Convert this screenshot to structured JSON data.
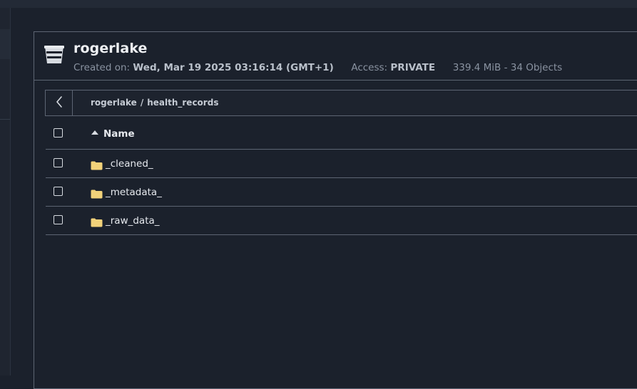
{
  "bucket": {
    "name": "rogerlake",
    "created_label": "Created on:",
    "created_value": "Wed, Mar 19 2025 03:16:14 (GMT+1)",
    "access_label": "Access:",
    "access_value": "PRIVATE",
    "size_objects": "339.4 MiB - 34 Objects"
  },
  "breadcrumb": {
    "root": "rogerlake",
    "separator": "/",
    "current": "health_records"
  },
  "table": {
    "columns": {
      "name": "Name"
    },
    "sort": "ascending",
    "rows": [
      {
        "name": "_cleaned_",
        "type": "folder"
      },
      {
        "name": "_metadata_",
        "type": "folder"
      },
      {
        "name": "_raw_data_",
        "type": "folder"
      }
    ]
  },
  "icons": {
    "bucket": "bucket-icon",
    "back": "chevron-left-icon",
    "folder": "folder-icon",
    "sort": "sort-ascending-icon"
  },
  "colors": {
    "background": "#1b212c",
    "border": "#5d6573",
    "folder": "#f2d27a"
  }
}
